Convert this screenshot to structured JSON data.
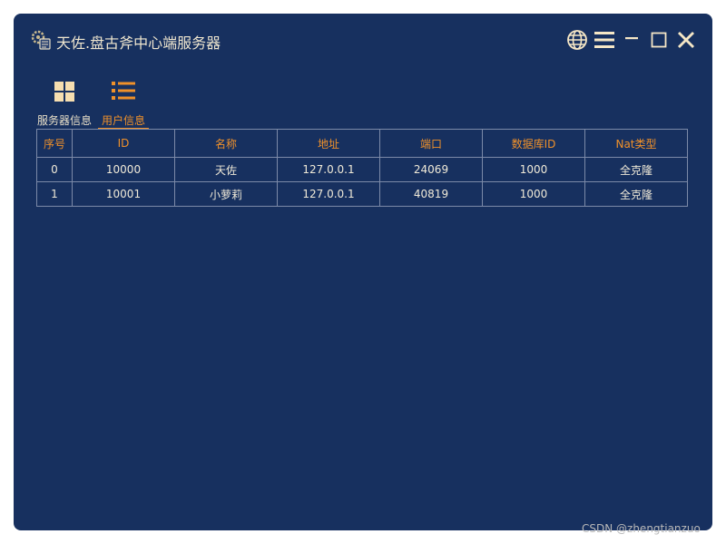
{
  "window": {
    "title": "天佐.盘古斧中心端服务器",
    "app_icon": "printer-gear-icon",
    "controls": [
      {
        "name": "language-button",
        "icon": "globe-icon"
      },
      {
        "name": "menu-button",
        "icon": "hamburger-icon"
      },
      {
        "name": "minimize-button",
        "icon": "minimize-icon"
      },
      {
        "name": "maximize-button",
        "icon": "maximize-icon"
      },
      {
        "name": "close-button",
        "icon": "close-icon"
      }
    ],
    "background": "#17305f"
  },
  "nav": {
    "items": [
      {
        "label": "服务器信息",
        "icon": "grid-icon",
        "active": false
      },
      {
        "label": "用户信息",
        "icon": "list-icon",
        "active": true
      }
    ],
    "accent": "#f0912a",
    "icon_color": "#f6deb0"
  },
  "table": {
    "columns": [
      "序号",
      "ID",
      "名称",
      "地址",
      "端口",
      "数据库ID",
      "Nat类型"
    ],
    "rows": [
      [
        "0",
        "10000",
        "天佐",
        "127.0.0.1",
        "24069",
        "1000",
        "全克隆"
      ],
      [
        "1",
        "10001",
        "小萝莉",
        "127.0.0.1",
        "40819",
        "1000",
        "全克隆"
      ]
    ]
  },
  "watermark": "CSDN @zhengtianzuo"
}
